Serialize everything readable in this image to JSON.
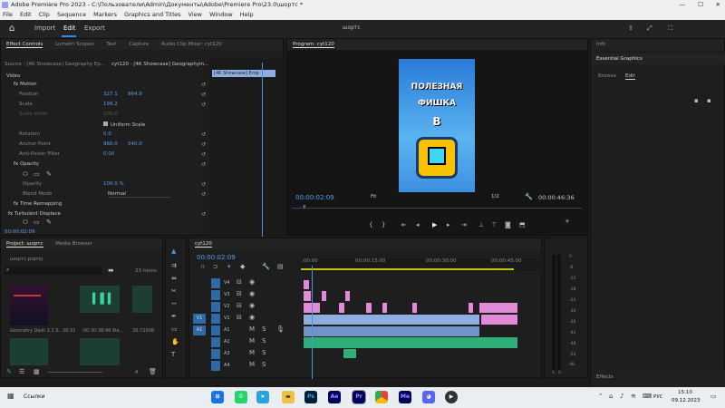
{
  "window": {
    "title": "Adobe Premiere Pro 2023 - C:\\Пользователи\\Admin\\Документы\\Adobe\\Premiere Pro\\23.0\\шортс *",
    "controls": [
      "—",
      "☐",
      "✕"
    ]
  },
  "menu": [
    "File",
    "Edit",
    "Clip",
    "Sequence",
    "Markers",
    "Graphics and Titles",
    "View",
    "Window",
    "Help"
  ],
  "nav": {
    "tabs": [
      "Import",
      "Edit",
      "Export"
    ],
    "center_title": "шортс"
  },
  "effect_controls": {
    "tabs": [
      "Effect Controls",
      "Lumetri Scopes",
      "Text",
      "Capture",
      "Audio Clip Mixer: cyt120"
    ],
    "source_label": "Source - [4K Showcase] Geography Ep...",
    "seq_label": "cyt120 - [4K Showcase] Geographyin...",
    "clip_chip": "[4K Showcase]",
    "clip_chip2": "Emp",
    "video_label": "Video",
    "motion": "Motion",
    "position": {
      "label": "Position",
      "x": "327.1",
      "y": "964.9"
    },
    "scale": {
      "label": "Scale",
      "v": "199.2"
    },
    "scale_width": {
      "label": "Scale Width",
      "v": "100.0"
    },
    "uniform": "Uniform Scale",
    "rotation": {
      "label": "Rotation",
      "v": "0.0"
    },
    "anchor": {
      "label": "Anchor Point",
      "x": "960.0",
      "y": "540.0"
    },
    "antiflicker": {
      "label": "Anti-flicker Filter",
      "v": "0.00"
    },
    "opacity_section": "Opacity",
    "opacity": {
      "label": "Opacity",
      "v": "100.0 %"
    },
    "blend": {
      "label": "Blend Mode",
      "v": "Normal"
    },
    "time_remap": "Time Remapping",
    "turbulent": "Turbulent Displace",
    "timecode": "00:00:02:09"
  },
  "program": {
    "title": "Program: cyt120",
    "thumb_lines": [
      "ПОЛЕЗНАЯ",
      "ФИШКА",
      "В"
    ],
    "timecode": "00:00:02:09",
    "fit": "Fit",
    "ratio": "1/2",
    "duration": "00:00:46:36"
  },
  "essential": {
    "info": "Info",
    "title": "Essential Graphics",
    "tabs": [
      "Browse",
      "Edit"
    ],
    "effects": "Effects"
  },
  "project": {
    "tabs": [
      "Project: шортс",
      "Media Browser"
    ],
    "file": "шортс.prproj",
    "search_ph": "",
    "count": "23 items",
    "items": [
      {
        "name": "Geometry Dash 2.2 S...",
        "dur": "38:31"
      },
      {
        "name": "-00:30:38:48 Фа...",
        "dur": ""
      },
      {
        "name": "28:72908",
        "dur": ""
      }
    ]
  },
  "timeline": {
    "seq": "cyt120",
    "timecode": "00:00:02:09",
    "ruler": [
      ":00:00",
      "00:00:15:00",
      "00:00:30:00",
      "00:00:45:00"
    ],
    "video_tracks": [
      "V4",
      "V3",
      "V2",
      "V1"
    ],
    "audio_tracks": [
      "A1",
      "A2",
      "A3",
      "A4"
    ],
    "src_v": "V1",
    "src_a": "A1"
  },
  "meter": {
    "labels": [
      "0",
      "-6",
      "-12",
      "-18",
      "-24",
      "-30",
      "-36",
      "-42",
      "-48",
      "-54",
      "dB"
    ],
    "footer": [
      "S",
      "S"
    ]
  },
  "taskbar": {
    "search": "Ссылки",
    "apps": [
      "Ps",
      "Ae",
      "Pr",
      "",
      "Me",
      "",
      ""
    ],
    "lang": "РУС",
    "time": "15:10",
    "date": "09.12.2023"
  },
  "colors": {
    "accent": "#2d8ceb",
    "timecode": "#5aa0e8",
    "video_clip": "#e08ad8",
    "audio_clip": "#2fae7a",
    "adjust_clip": "#8faee0",
    "playhead": "#4a90e2"
  }
}
